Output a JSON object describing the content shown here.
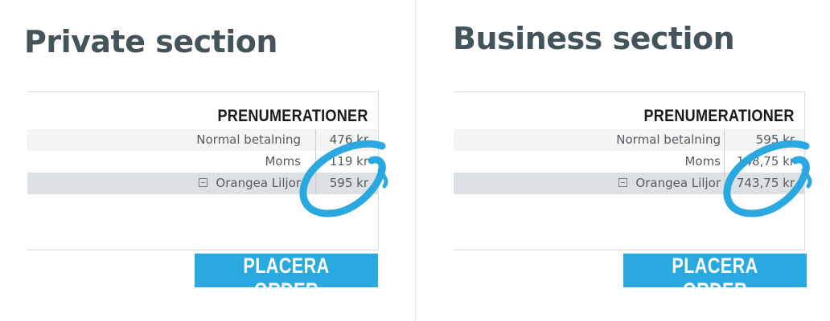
{
  "accent_color": "#2aa8e0",
  "private": {
    "title": "Private section",
    "heading": "PRENUMERATIONER",
    "rows": [
      {
        "label": "Normal betalning",
        "value": "476 kr"
      },
      {
        "label": "Moms",
        "value": "119 kr"
      },
      {
        "label": "Orangea Liljor",
        "value": "595 kr",
        "icon": "collapse-icon"
      }
    ],
    "button": "PLACERA ORDER"
  },
  "business": {
    "title": "Business section",
    "heading": "PRENUMERATIONER",
    "rows": [
      {
        "label": "Normal betalning",
        "value": "595 kr"
      },
      {
        "label": "Moms",
        "value": "148,75 kr"
      },
      {
        "label": "Orangea Liljor",
        "value": "743,75 kr",
        "icon": "collapse-icon"
      }
    ],
    "button": "PLACERA ORDER"
  }
}
